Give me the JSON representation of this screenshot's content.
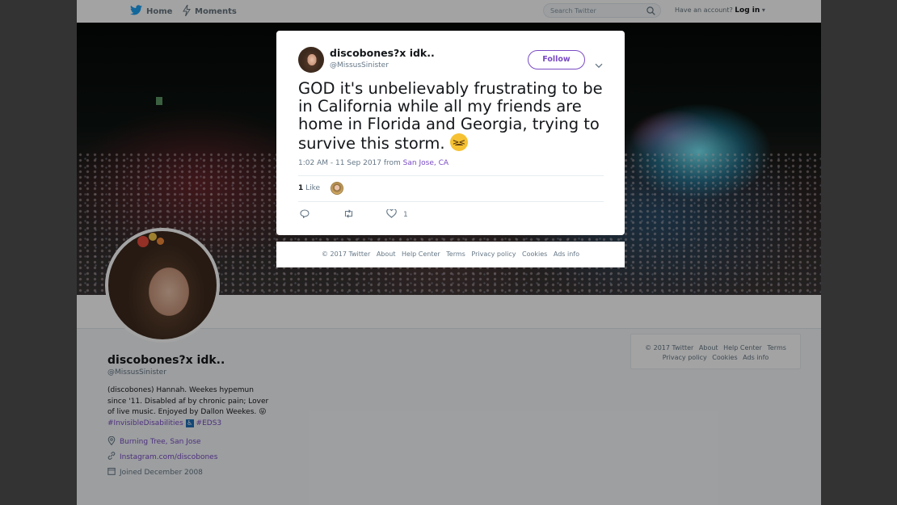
{
  "topbar": {
    "home_label": "Home",
    "moments_label": "Moments",
    "search_placeholder": "Search Twitter",
    "account_prompt": "Have an account?",
    "login_label": "Log in"
  },
  "profile": {
    "name": "discobones?x idk..",
    "handle": "@MissusSinister",
    "bio_text": "(discobones) Hannah. Weekes hypemun since '11. Disabled af by chronic pain; Lover of live music. Enjoyed by Dallon Weekes.",
    "bio_tag1": "#InvisibleDisabilities",
    "bio_tag2": "#EDS3",
    "location": "Burning Tree, San Jose",
    "website": "Instagram.com/discobones",
    "joined": "Joined December 2008"
  },
  "side_footer": {
    "links": [
      "© 2017 Twitter",
      "About",
      "Help Center",
      "Terms",
      "Privacy policy",
      "Cookies",
      "Ads info"
    ]
  },
  "tweet": {
    "author_name": "discobones?x idk..",
    "author_handle": "@MissusSinister",
    "follow_label": "Follow",
    "text": "GOD it's unbelievably frustrating to be in California while all my friends are home in Florida and Georgia, trying to survive this storm.",
    "timestamp": "1:02 AM - 11 Sep 2017 from ",
    "location": "San Jose, CA",
    "like_count": "1",
    "like_label": "Like",
    "action_like_count": "1"
  },
  "modal_footer": {
    "links": [
      "© 2017 Twitter",
      "About",
      "Help Center",
      "Terms",
      "Privacy policy",
      "Cookies",
      "Ads info"
    ]
  },
  "colors": {
    "accent": "#794bc4",
    "twitter_blue": "#1da1f2",
    "muted": "#657786"
  },
  "icons": [
    "twitter-bird-icon",
    "lightning-icon",
    "search-icon",
    "chevron-down-icon",
    "reply-icon",
    "retweet-icon",
    "heart-icon",
    "location-pin-icon",
    "link-icon",
    "calendar-icon",
    "emoji-icon"
  ]
}
